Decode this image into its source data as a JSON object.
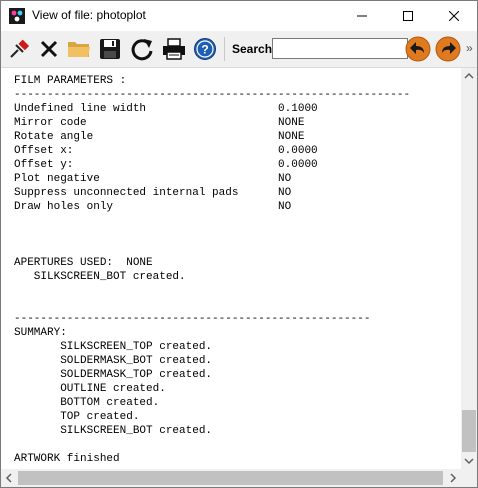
{
  "window": {
    "title": "View of file: photoplot"
  },
  "toolbar": {
    "search_label": "Search:",
    "search_value": "",
    "icons": [
      "pin-icon",
      "close-x-icon",
      "folder-icon",
      "save-disk-icon",
      "refresh-icon",
      "print-icon",
      "help-icon",
      "back-arrow-icon",
      "forward-arrow-icon"
    ],
    "nav_color": "#e07a1f"
  },
  "content": {
    "lines": [
      "FILM PARAMETERS :",
      "------------------------------------------------------------",
      "Undefined line width                    0.1000",
      "Mirror code                             NONE",
      "Rotate angle                            NONE",
      "Offset x:                               0.0000",
      "Offset y:                               0.0000",
      "Plot negative                           NO",
      "Suppress unconnected internal pads      NO",
      "Draw holes only                         NO",
      "",
      "",
      "",
      "APERTURES USED:  NONE",
      "   SILKSCREEN_BOT created.",
      "",
      "",
      "------------------------------------------------------",
      "SUMMARY:",
      "       SILKSCREEN_TOP created.",
      "       SOLDERMASK_BOT created.",
      "       SOLDERMASK_TOP created.",
      "       OUTLINE created.",
      "       BOTTOM created.",
      "       TOP created.",
      "       SILKSCREEN_BOT created.",
      "",
      "ARTWORK finished"
    ]
  }
}
